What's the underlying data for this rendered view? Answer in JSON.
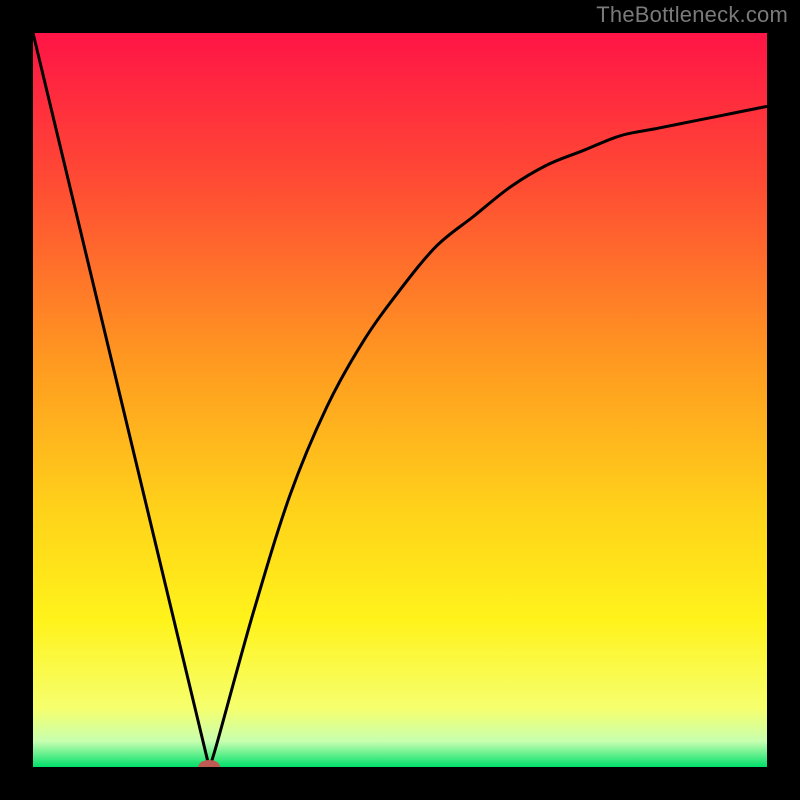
{
  "watermark": "TheBottleneck.com",
  "chart_data": {
    "type": "line",
    "title": "",
    "xlabel": "",
    "ylabel": "",
    "xlim": [
      0,
      100
    ],
    "ylim": [
      0,
      100
    ],
    "x": [
      0,
      5,
      10,
      15,
      20,
      24,
      25,
      30,
      35,
      40,
      45,
      50,
      55,
      60,
      65,
      70,
      75,
      80,
      85,
      90,
      95,
      100
    ],
    "values": [
      100,
      79,
      58,
      37,
      16,
      0,
      3,
      21,
      37,
      49,
      58,
      65,
      71,
      75,
      79,
      82,
      84,
      86,
      87,
      88,
      89,
      90
    ],
    "marker": {
      "x": 24,
      "y": 0
    },
    "gradient_stops": [
      {
        "pos": 0.0,
        "color": "#ff1446"
      },
      {
        "pos": 0.2,
        "color": "#ff4a34"
      },
      {
        "pos": 0.45,
        "color": "#ff9a20"
      },
      {
        "pos": 0.65,
        "color": "#ffd21a"
      },
      {
        "pos": 0.8,
        "color": "#fff31b"
      },
      {
        "pos": 0.92,
        "color": "#f6ff6e"
      },
      {
        "pos": 0.965,
        "color": "#c8ffb0"
      },
      {
        "pos": 1.0,
        "color": "#00e06a"
      }
    ],
    "marker_color": "#c05a55",
    "curve_color": "#000000"
  }
}
